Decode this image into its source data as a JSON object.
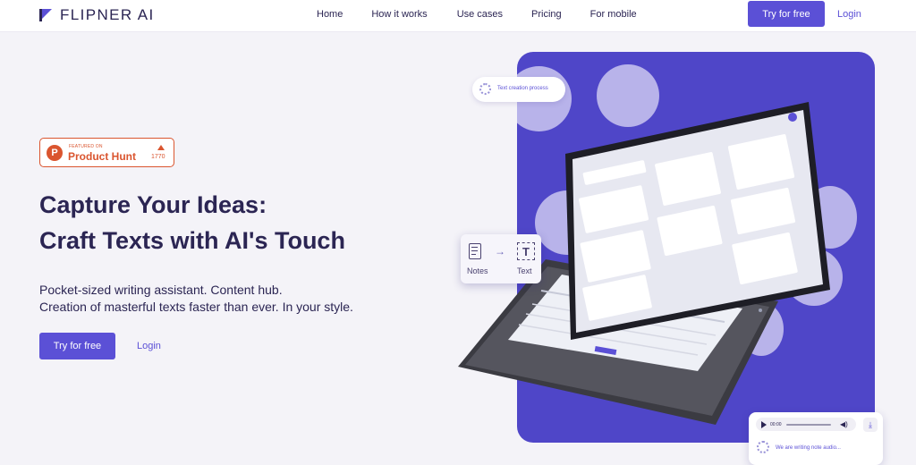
{
  "brand": {
    "name": "FLIPNER AI"
  },
  "nav": {
    "links": [
      "Home",
      "How it works",
      "Use cases",
      "Pricing",
      "For mobile"
    ],
    "try_label": "Try for free",
    "login_label": "Login"
  },
  "badge": {
    "small": "FEATURED ON",
    "name": "Product Hunt",
    "count": "1770"
  },
  "hero": {
    "title_line1": "Capture Your Ideas:",
    "title_line2": "Craft Texts with AI's Touch",
    "subtitle_line1": "Pocket-sized writing assistant. Content hub.",
    "subtitle_line2": "Creation of masterful texts faster than ever. In your style.",
    "try_label": "Try for free",
    "login_label": "Login"
  },
  "illustration": {
    "pill_text": "Text creation process",
    "notes_label": "Notes",
    "text_label": "Text",
    "audio_time": "00:00",
    "audio_status": "We are writing note audio..."
  },
  "colors": {
    "accent": "#5b50d6",
    "panel": "#4f46c8",
    "ink": "#2b2553",
    "product_hunt": "#da552f"
  }
}
